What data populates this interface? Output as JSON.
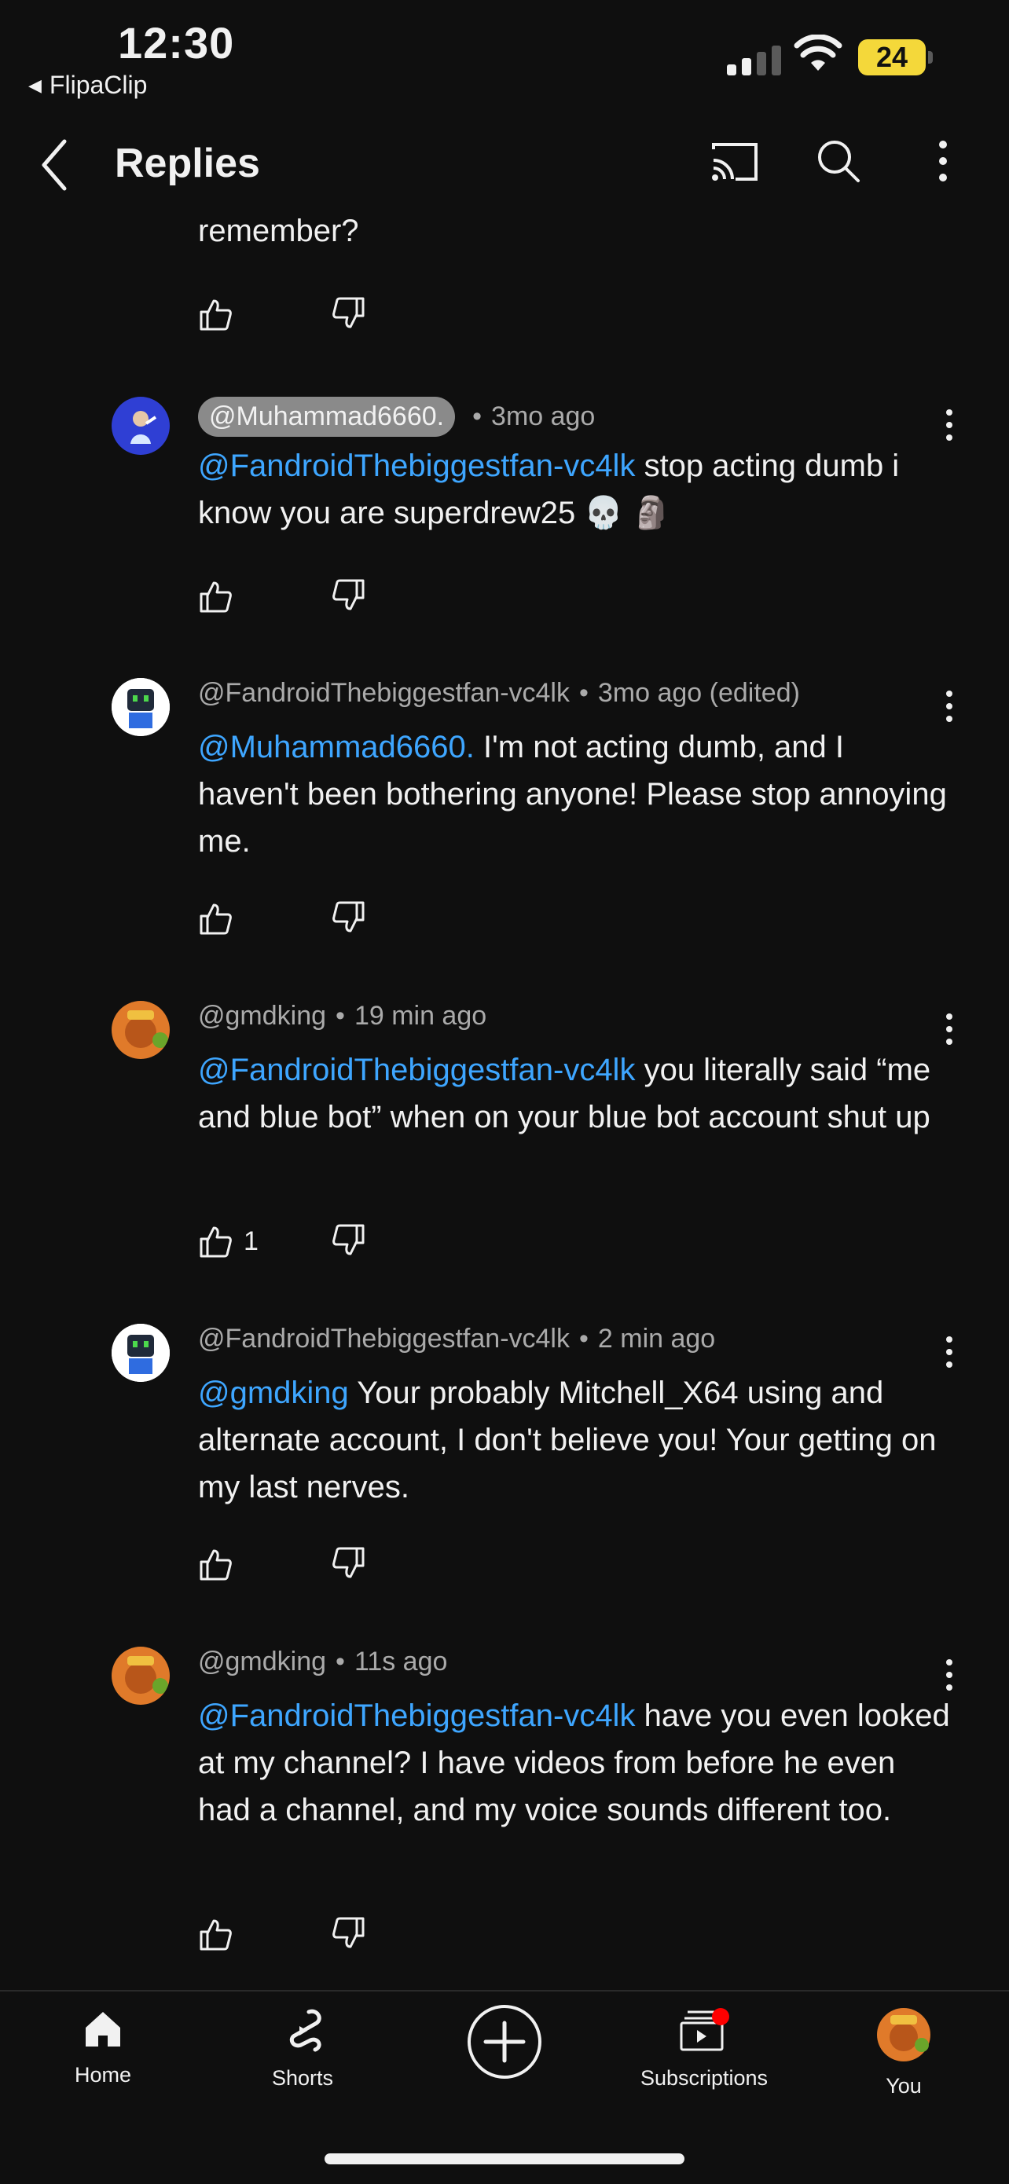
{
  "status": {
    "time": "12:30",
    "back_app": "FlipaClip",
    "battery": "24"
  },
  "header": {
    "title": "Replies"
  },
  "partial_text": "remember?",
  "comments": [
    {
      "author": "@Muhammad6660.",
      "time": "3mo ago",
      "mention": "@FandroidThebiggestfan-vc4lk",
      "text": " stop acting dumb i know you are superdrew25 💀 🗿",
      "likes": ""
    },
    {
      "author": "@FandroidThebiggestfan-vc4lk",
      "time": "3mo ago (edited)",
      "mention": "@Muhammad6660.",
      "text": "  I'm not acting dumb, and I haven't been bothering anyone! Please stop annoying me.",
      "likes": ""
    },
    {
      "author": "@gmdking",
      "time": "19 min ago",
      "mention": "@FandroidThebiggestfan-vc4lk",
      "text": " you literally said “me and blue bot” when on your blue bot account shut up",
      "likes": "1"
    },
    {
      "author": "@FandroidThebiggestfan-vc4lk",
      "time": "2 min ago",
      "mention": "@gmdking",
      "text": "  Your probably Mitchell_X64 using and alternate account, I don't believe you! Your getting on my last nerves.",
      "likes": ""
    },
    {
      "author": "@gmdking",
      "time": "11s ago",
      "mention": "@FandroidThebiggestfan-vc4lk",
      "text": "  have you even looked at my channel? I have videos from before he even had a channel, and my voice sounds different too.",
      "likes": ""
    }
  ],
  "nav": {
    "home": "Home",
    "shorts": "Shorts",
    "subscriptions": "Subscriptions",
    "you": "You"
  },
  "colors": {
    "background": "#0f0f0f",
    "mention": "#3ea6ff",
    "battery": "#f4d83a",
    "notification": "#ff0000"
  }
}
